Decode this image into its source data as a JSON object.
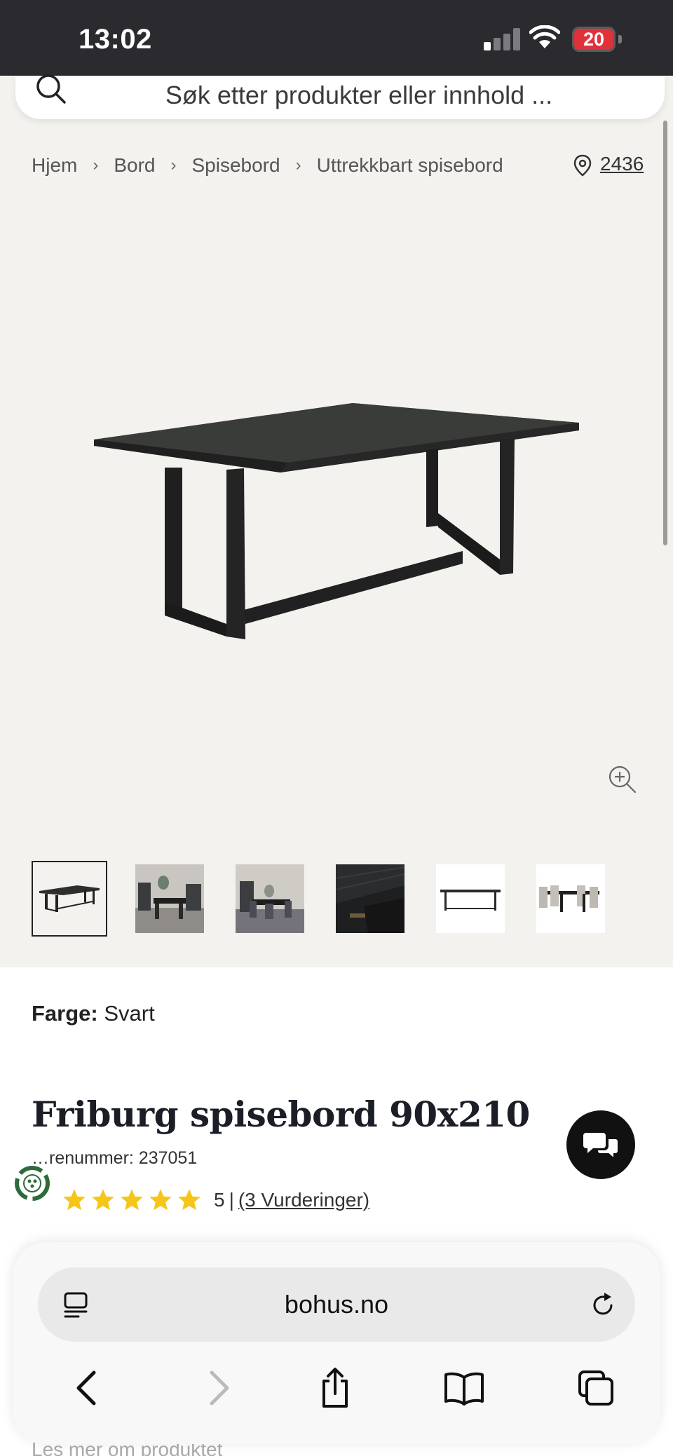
{
  "status_bar": {
    "time": "13:02",
    "battery_level": "20",
    "signal_bars_active": 1,
    "signal_bars_total": 4
  },
  "search": {
    "placeholder": "Søk etter produkter eller innhold ..."
  },
  "breadcrumb": {
    "items": [
      "Hjem",
      "Bord",
      "Spisebord",
      "Uttrekkbart spisebord"
    ]
  },
  "store": {
    "number": "2436"
  },
  "gallery": {
    "thumbnails": [
      "table-product",
      "dining-room",
      "dining-room-2",
      "wood-detail",
      "table-product-white",
      "dining-set"
    ],
    "selected_index": 0
  },
  "product": {
    "color_label": "Farge:",
    "color_value": "Svart",
    "title": "Friburg spisebord 90x210",
    "sku_text": "…renummer: 237051",
    "rating_value": "5",
    "rating_separator": "|",
    "reviews_link": "(3 Vurderinger)",
    "stars": 5,
    "read_more": "Les mer om produktet"
  },
  "browser": {
    "url": "bohus.no"
  },
  "colors": {
    "status_bar_bg": "#2b2a2e",
    "page_bg": "#f4f2ef",
    "star": "#f5c518",
    "battery_low": "#e0313a",
    "chat_button": "#111111"
  }
}
